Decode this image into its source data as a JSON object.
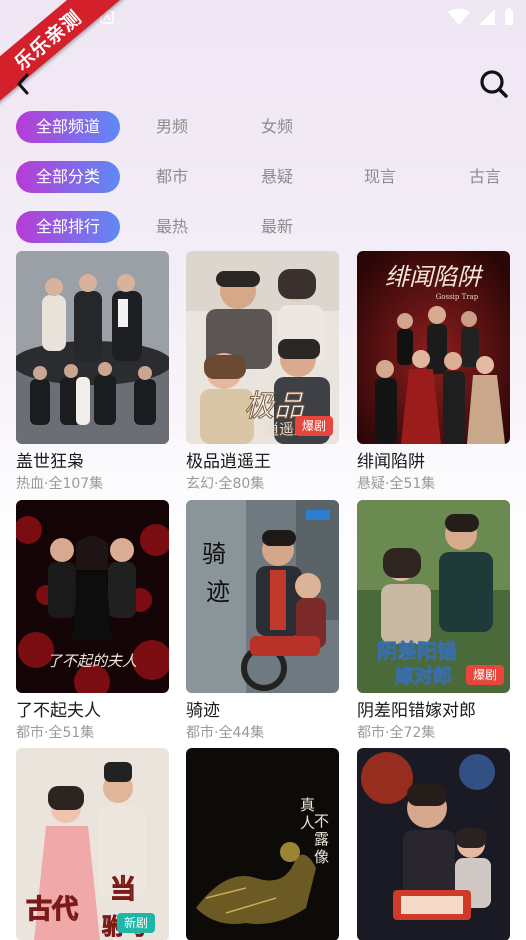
{
  "watermark": "乐乐亲测",
  "filters": {
    "channel": {
      "active": "全部频道",
      "options": [
        "男频",
        "女频"
      ]
    },
    "category": {
      "active": "全部分类",
      "options": [
        "都市",
        "悬疑",
        "现言",
        "古言"
      ]
    },
    "rank": {
      "active": "全部排行",
      "options": [
        "最热",
        "最新"
      ]
    }
  },
  "dramas": [
    {
      "title": "盖世狂枭",
      "meta": "热血·全107集",
      "tag": ""
    },
    {
      "title": "极品逍遥王",
      "meta": "玄幻·全80集",
      "tag": "爆剧",
      "poster_text": "极品逍遥王"
    },
    {
      "title": "绯闻陷阱",
      "meta": "悬疑·全51集",
      "tag": "",
      "poster_text": "绯闻陷阱",
      "poster_subtext": "Gossip Trap"
    },
    {
      "title": "了不起夫人",
      "meta": "都市·全51集",
      "tag": "",
      "poster_text": "了不起的夫人"
    },
    {
      "title": "骑迹",
      "meta": "都市·全44集",
      "tag": "",
      "poster_text": "骑迹"
    },
    {
      "title": "阴差阳错嫁对郎",
      "meta": "都市·全72集",
      "tag": "爆剧",
      "poster_text": "阴差阳错嫁对郎"
    },
    {
      "title": "",
      "meta": "",
      "tag": "新剧",
      "poster_text": "古代当驸马"
    },
    {
      "title": "",
      "meta": "",
      "tag": "",
      "poster_text": "真人不露像"
    },
    {
      "title": "",
      "meta": "",
      "tag": ""
    }
  ],
  "colors": {
    "accent_start": "#b83bd6",
    "accent_end": "#5e8af5",
    "hot_tag": "#e8453c",
    "new_tag": "#1fb6a8"
  }
}
